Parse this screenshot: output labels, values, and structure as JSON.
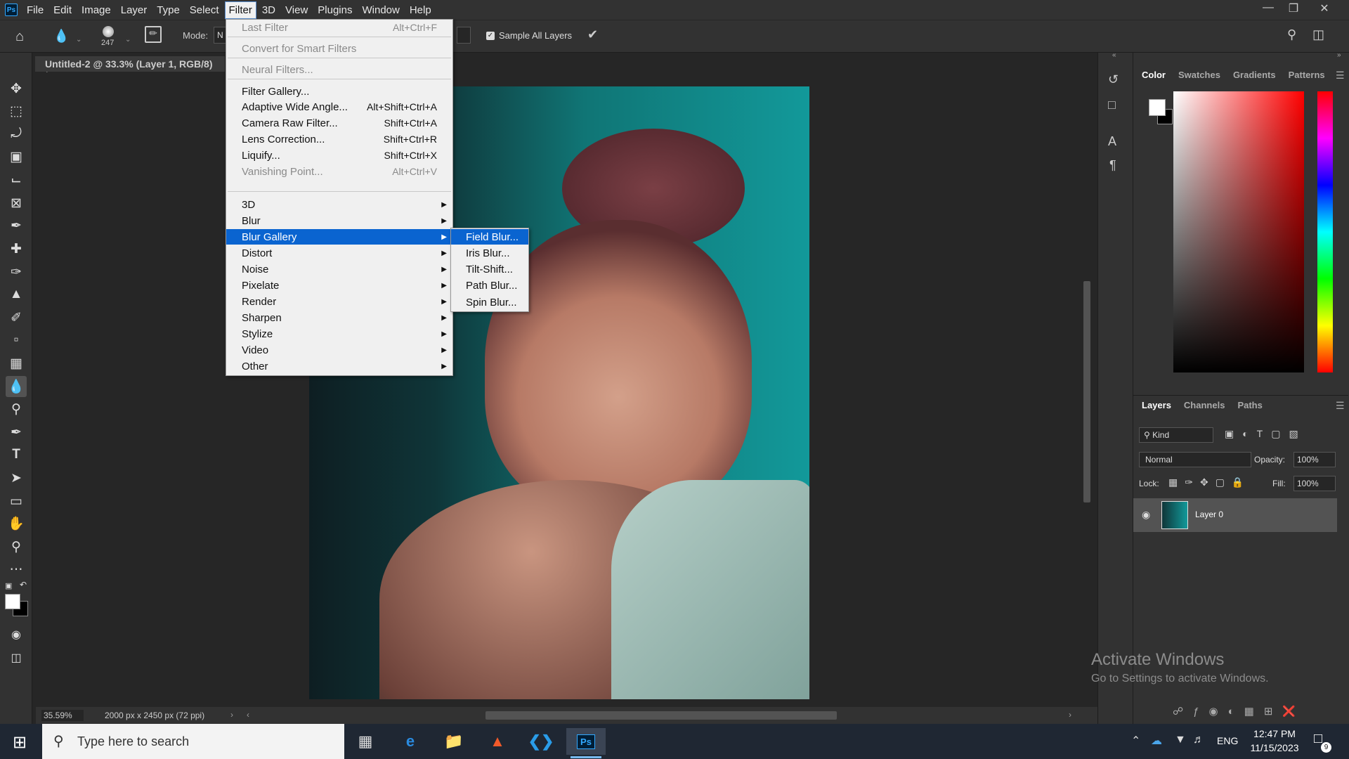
{
  "app": {
    "logo": "Ps"
  },
  "menubar": {
    "items": [
      "File",
      "Edit",
      "Image",
      "Layer",
      "Type",
      "Select",
      "Filter",
      "3D",
      "View",
      "Plugins",
      "Window",
      "Help"
    ],
    "active": "Filter"
  },
  "options": {
    "brush_size": "247",
    "mode_label": "Mode:",
    "mode_value": "N",
    "sample_all_layers": "Sample All Layers"
  },
  "document": {
    "tab_title": "Untitled-2 @ 33.3% (Layer 1, RGB/8) *",
    "zoom": "35.59%",
    "dimensions": "2000 px x 2450 px (72 ppi)"
  },
  "filter_menu": {
    "last_filter": {
      "label": "Last Filter",
      "shortcut": "Alt+Ctrl+F"
    },
    "convert_smart": "Convert for Smart Filters",
    "neural": "Neural Filters...",
    "filter_gallery": "Filter Gallery...",
    "adaptive": {
      "label": "Adaptive Wide Angle...",
      "shortcut": "Alt+Shift+Ctrl+A"
    },
    "camera_raw": {
      "label": "Camera Raw Filter...",
      "shortcut": "Shift+Ctrl+A"
    },
    "lens": {
      "label": "Lens Correction...",
      "shortcut": "Shift+Ctrl+R"
    },
    "liquify": {
      "label": "Liquify...",
      "shortcut": "Shift+Ctrl+X"
    },
    "vanishing": {
      "label": "Vanishing Point...",
      "shortcut": "Alt+Ctrl+V"
    },
    "submenus": [
      "3D",
      "Blur",
      "Blur Gallery",
      "Distort",
      "Noise",
      "Pixelate",
      "Render",
      "Sharpen",
      "Stylize",
      "Video",
      "Other"
    ],
    "highlighted": "Blur Gallery"
  },
  "blur_gallery": {
    "items": [
      "Field Blur...",
      "Iris Blur...",
      "Tilt-Shift...",
      "Path Blur...",
      "Spin Blur..."
    ],
    "highlighted": "Field Blur..."
  },
  "color_panel": {
    "tabs": [
      "Color",
      "Swatches",
      "Gradients",
      "Patterns"
    ],
    "active": "Color"
  },
  "layers_panel": {
    "tabs": [
      "Layers",
      "Channels",
      "Paths"
    ],
    "active": "Layers",
    "filter_kind": "Kind",
    "blend_mode": "Normal",
    "opacity_label": "Opacity:",
    "opacity": "100%",
    "lock_label": "Lock:",
    "fill_label": "Fill:",
    "fill": "100%",
    "layers": [
      {
        "name": "Layer 0",
        "visible": true
      }
    ]
  },
  "watermark": {
    "title": "Activate Windows",
    "subtitle": "Go to Settings to activate Windows."
  },
  "taskbar": {
    "search_placeholder": "Type here to search",
    "language": "ENG",
    "time": "12:47 PM",
    "date": "11/15/2023",
    "notification_count": "9"
  },
  "colors": {
    "highlight": "#0a64d0",
    "panel_bg": "#323232",
    "canvas_bg": "#262626"
  }
}
